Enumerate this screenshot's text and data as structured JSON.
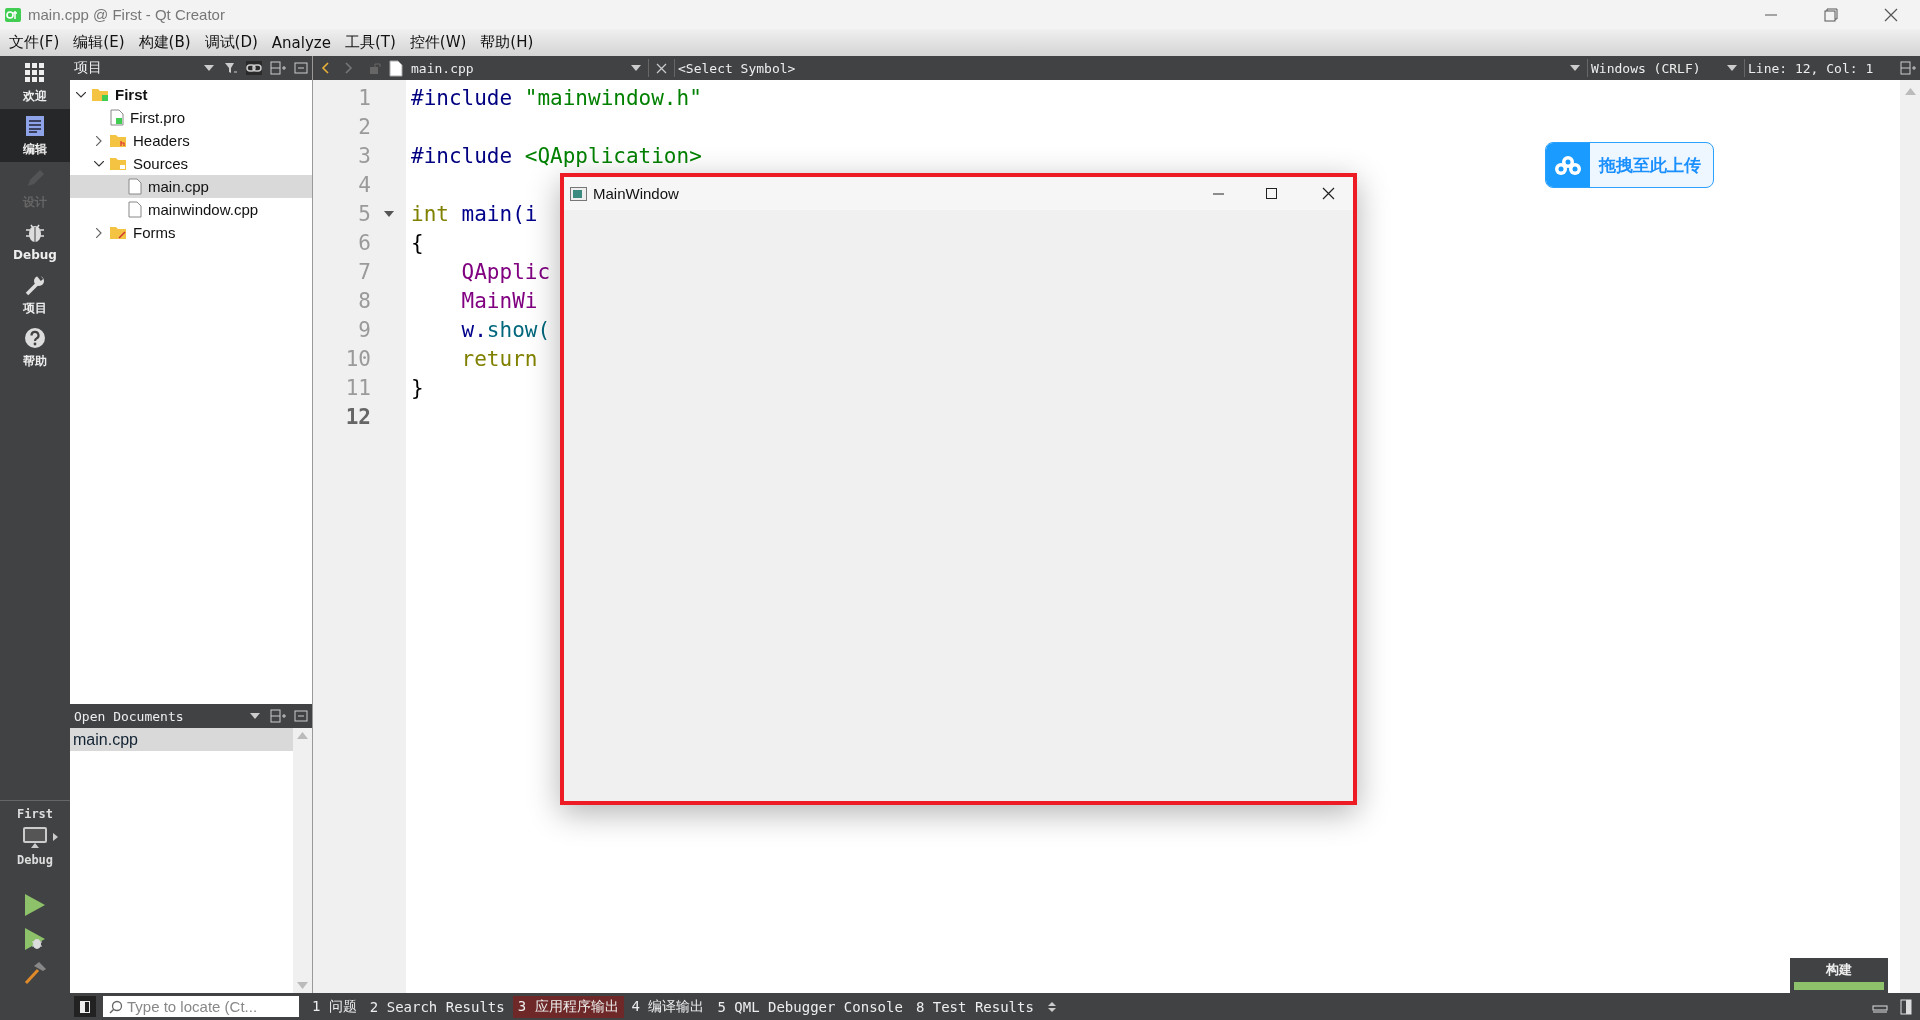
{
  "window": {
    "title": "main.cpp @ First - Qt Creator"
  },
  "menu": [
    "文件(F)",
    "编辑(E)",
    "构建(B)",
    "调试(D)",
    "Analyze",
    "工具(T)",
    "控件(W)",
    "帮助(H)"
  ],
  "modes": [
    {
      "label": "欢迎",
      "kind": "welcome",
      "selected": false,
      "disabled": false
    },
    {
      "label": "编辑",
      "kind": "edit",
      "selected": true,
      "disabled": false
    },
    {
      "label": "设计",
      "kind": "design",
      "selected": false,
      "disabled": true
    },
    {
      "label": "Debug",
      "kind": "debug",
      "selected": false,
      "disabled": false
    },
    {
      "label": "项目",
      "kind": "projects",
      "selected": false,
      "disabled": false
    },
    {
      "label": "帮助",
      "kind": "help",
      "selected": false,
      "disabled": false
    }
  ],
  "target": {
    "project": "First",
    "config": "Debug"
  },
  "project_panel": {
    "title": "项目",
    "tree": [
      {
        "label": "First",
        "kind": "project",
        "expanded": true,
        "selected": false,
        "children": [
          {
            "label": "First.pro",
            "kind": "pro",
            "selected": false
          },
          {
            "label": "Headers",
            "kind": "headers",
            "expanded": false,
            "selected": false
          },
          {
            "label": "Sources",
            "kind": "sources",
            "expanded": true,
            "selected": false,
            "children": [
              {
                "label": "main.cpp",
                "kind": "file",
                "selected": true
              },
              {
                "label": "mainwindow.cpp",
                "kind": "file",
                "selected": false
              }
            ]
          },
          {
            "label": "Forms",
            "kind": "forms",
            "expanded": false,
            "selected": false
          }
        ]
      }
    ]
  },
  "open_documents": {
    "title": "Open Documents",
    "items": [
      {
        "label": "main.cpp",
        "selected": true
      }
    ]
  },
  "editor_toolbar": {
    "file": "main.cpp",
    "symbol": "<Select Symbol>",
    "line_endings": "Windows (CRLF)",
    "position": "Line: 12, Col: 1"
  },
  "editor": {
    "lines": [
      {
        "number": "1",
        "current": false,
        "foldable": false,
        "tokens": [
          {
            "text": "#include ",
            "kind": "preproc"
          },
          {
            "text": "\"mainwindow.h\"",
            "kind": "string"
          }
        ]
      },
      {
        "number": "2",
        "current": false,
        "foldable": false
      },
      {
        "number": "3",
        "current": false,
        "foldable": false,
        "tokens": [
          {
            "text": "#include ",
            "kind": "preproc"
          },
          {
            "text": "<QApplication>",
            "kind": "string"
          }
        ]
      },
      {
        "number": "4",
        "current": false,
        "foldable": false
      },
      {
        "number": "5",
        "current": false,
        "foldable": true,
        "tokens": [
          {
            "text": "int",
            "kind": "keyword"
          },
          {
            "text": " main(i",
            "kind": "function"
          }
        ]
      },
      {
        "number": "6",
        "current": false,
        "foldable": false,
        "tokens": [
          {
            "text": "{",
            "kind": "plain"
          }
        ]
      },
      {
        "number": "7",
        "current": false,
        "foldable": false,
        "tokens": [
          {
            "text": "    QApplic",
            "kind": "type"
          }
        ]
      },
      {
        "number": "8",
        "current": false,
        "foldable": false,
        "tokens": [
          {
            "text": "    MainWi",
            "kind": "type"
          }
        ]
      },
      {
        "number": "9",
        "current": false,
        "foldable": false,
        "tokens": [
          {
            "text": "    w.",
            "kind": "function"
          },
          {
            "text": "show(",
            "kind": "method"
          }
        ]
      },
      {
        "number": "10",
        "current": false,
        "foldable": false,
        "tokens": [
          {
            "text": "    return",
            "kind": "keyword"
          }
        ]
      },
      {
        "number": "11",
        "current": false,
        "foldable": false,
        "tokens": [
          {
            "text": "}",
            "kind": "plain"
          }
        ]
      },
      {
        "number": "12",
        "current": true,
        "foldable": false
      }
    ]
  },
  "app_window": {
    "title": "MainWindow",
    "highlighted": true
  },
  "upload_button": {
    "label": "拖拽至此上传"
  },
  "build_progress": {
    "label": "构建",
    "level": 1
  },
  "locator": {
    "placeholder": "Type to locate (Ct..."
  },
  "output_tabs": [
    {
      "label": "1 问题",
      "selected": false
    },
    {
      "label": "2 Search Results",
      "selected": false
    },
    {
      "label": "3 应用程序输出",
      "selected": true
    },
    {
      "label": "4 编译输出",
      "selected": false
    },
    {
      "label": "5 QML Debugger Console",
      "selected": false
    },
    {
      "label": "8 Test Results",
      "selected": false
    }
  ]
}
